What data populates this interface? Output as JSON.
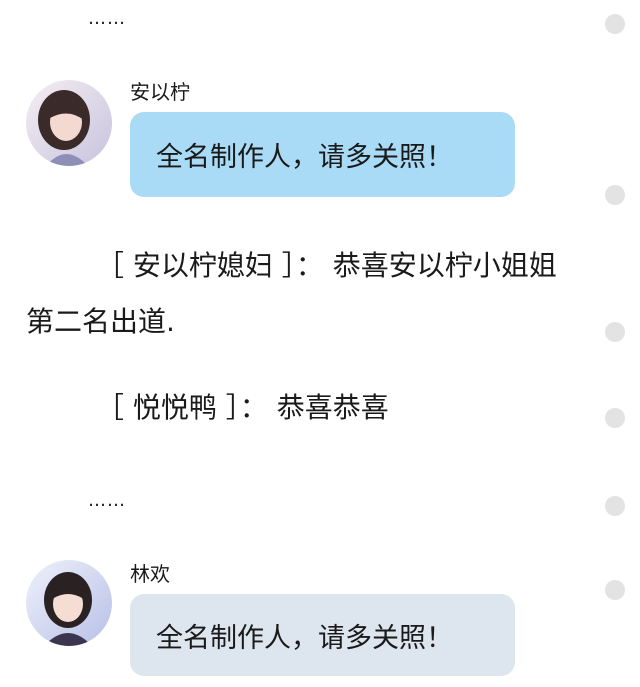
{
  "ellipsis_top": "……",
  "message1": {
    "sender": "安以柠",
    "text": "全名制作人，请多关照！"
  },
  "comment1": {
    "line1": "［ 安以柠媳妇 ］：  恭喜安以柠小姐姐",
    "line2": "第二名出道."
  },
  "comment2": {
    "line1": "［ 悦悦鸭 ］：  恭喜恭喜"
  },
  "ellipsis_bottom": "……",
  "message2": {
    "sender": "林欢",
    "text": "全名制作人，请多关照！"
  },
  "colors": {
    "bubble_blue": "#a9dbf7",
    "bubble_grey": "#dde5ee",
    "side_dot": "#e3e3e3"
  },
  "icons": {
    "avatar1": "avatar-photo",
    "avatar2": "avatar-photo"
  }
}
